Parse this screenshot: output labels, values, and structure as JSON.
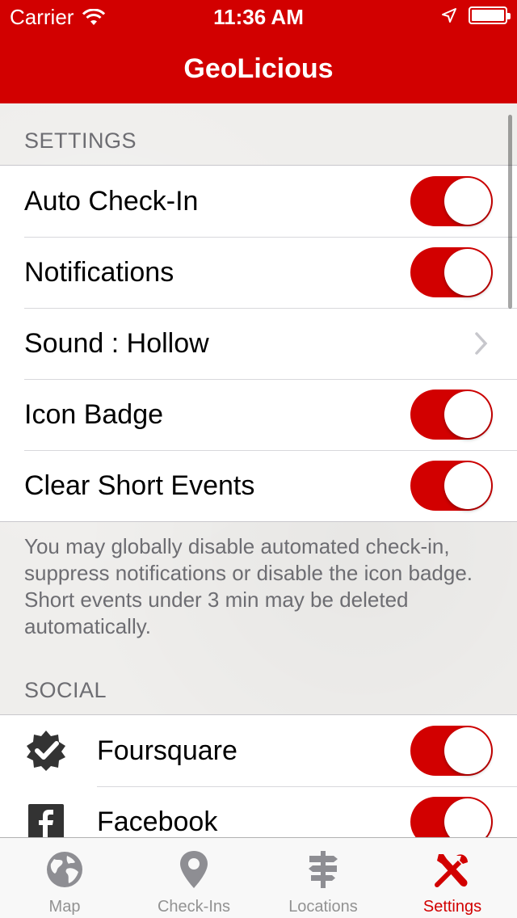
{
  "status_bar": {
    "carrier": "Carrier",
    "time": "11:36 AM"
  },
  "nav": {
    "title": "GeoLicious"
  },
  "settings_section": {
    "header": "SETTINGS",
    "rows": [
      {
        "label": "Auto Check-In",
        "type": "toggle",
        "on": true
      },
      {
        "label": "Notifications",
        "type": "toggle",
        "on": true
      },
      {
        "label": "Sound : Hollow",
        "type": "disclosure"
      },
      {
        "label": "Icon Badge",
        "type": "toggle",
        "on": true
      },
      {
        "label": "Clear Short Events",
        "type": "toggle",
        "on": true
      }
    ],
    "footer": "You may globally disable automated check-in, suppress notifications or disable the icon badge. Short events under 3 min may be deleted automatically."
  },
  "social_section": {
    "header": "SOCIAL",
    "rows": [
      {
        "label": "Foursquare",
        "icon": "foursquare-icon",
        "on": true
      },
      {
        "label": "Facebook",
        "icon": "facebook-icon",
        "on": true
      }
    ]
  },
  "tabbar": {
    "tabs": [
      {
        "label": "Map",
        "icon": "globe-icon",
        "active": false
      },
      {
        "label": "Check-Ins",
        "icon": "location-pin-icon",
        "active": false
      },
      {
        "label": "Locations",
        "icon": "signpost-icon",
        "active": false
      },
      {
        "label": "Settings",
        "icon": "tools-icon",
        "active": true
      }
    ]
  },
  "colors": {
    "accent": "#d20000",
    "inactive_tab": "#929292"
  }
}
